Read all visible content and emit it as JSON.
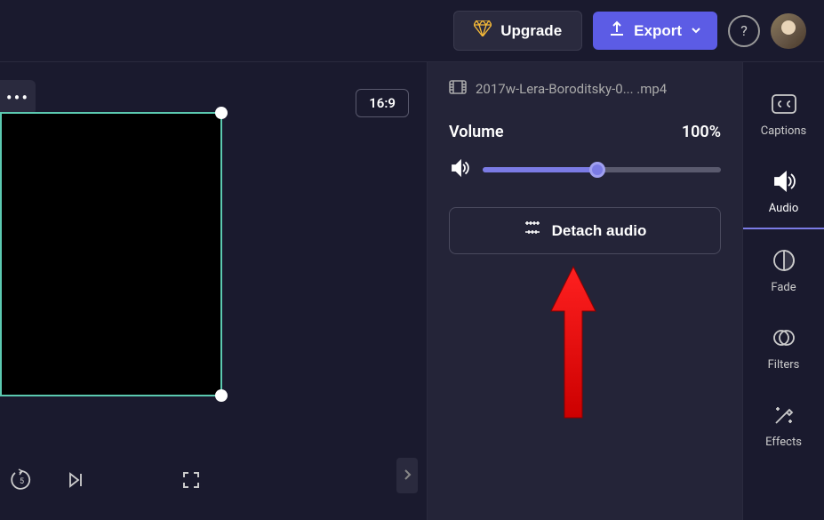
{
  "topbar": {
    "upgrade_label": "Upgrade",
    "export_label": "Export"
  },
  "canvas": {
    "aspect_ratio": "16:9"
  },
  "properties": {
    "file_name": "2017w-Lera-Boroditsky-0... .mp4",
    "volume_label": "Volume",
    "volume_value": "100%",
    "volume_slider_percent": 48,
    "detach_label": "Detach audio"
  },
  "sidebar": {
    "items": [
      {
        "label": "Captions",
        "name": "captions"
      },
      {
        "label": "Audio",
        "name": "audio"
      },
      {
        "label": "Fade",
        "name": "fade"
      },
      {
        "label": "Filters",
        "name": "filters"
      },
      {
        "label": "Effects",
        "name": "effects"
      }
    ],
    "active": "audio"
  }
}
